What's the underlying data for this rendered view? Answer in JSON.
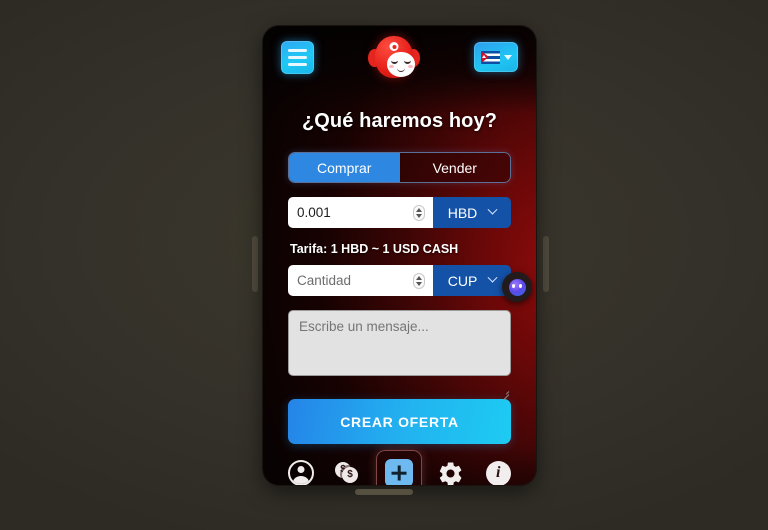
{
  "header": {
    "menu_icon": "hamburger-menu-icon",
    "logo_name": "app-logo-monkey-face",
    "language": {
      "flag": "cuba-flag-icon",
      "caret": "chevron-down-icon"
    }
  },
  "main": {
    "title": "¿Qué haremos hoy?",
    "mode_toggle": {
      "buy_label": "Comprar",
      "sell_label": "Vender",
      "selected": "Comprar"
    },
    "amount_field": {
      "value": "0.001",
      "placeholder": "0.001",
      "unit": "HBD",
      "spinner_icon": "number-stepper-icon"
    },
    "rate_note": "Tarifa: 1 HBD ~ 1 USD CASH",
    "quantity_field": {
      "value": "",
      "placeholder": "Cantidad",
      "unit": "CUP",
      "spinner_icon": "number-stepper-icon"
    },
    "message_field": {
      "value": "",
      "placeholder": "Escribe un mensaje..."
    },
    "submit_label": "CREAR OFERTA"
  },
  "chat_fab": {
    "icon": "chat-assistant-avatar-icon"
  },
  "bottom_nav": {
    "items": [
      {
        "icon": "account-person-icon",
        "active": false
      },
      {
        "icon": "coins-money-icon",
        "active": false
      },
      {
        "icon": "plus-add-icon",
        "active": true
      },
      {
        "icon": "gear-settings-icon",
        "active": false
      },
      {
        "icon": "info-icon",
        "active": false
      }
    ],
    "coin_symbol": "$",
    "info_symbol": "i"
  },
  "device": {
    "home_indicator": "home-indicator"
  },
  "colors": {
    "accent_blue": "#2e87e0",
    "accent_cyan": "#1dcbf2",
    "unit_blue": "#1452a8",
    "screen_red": "#8e0b0b"
  }
}
